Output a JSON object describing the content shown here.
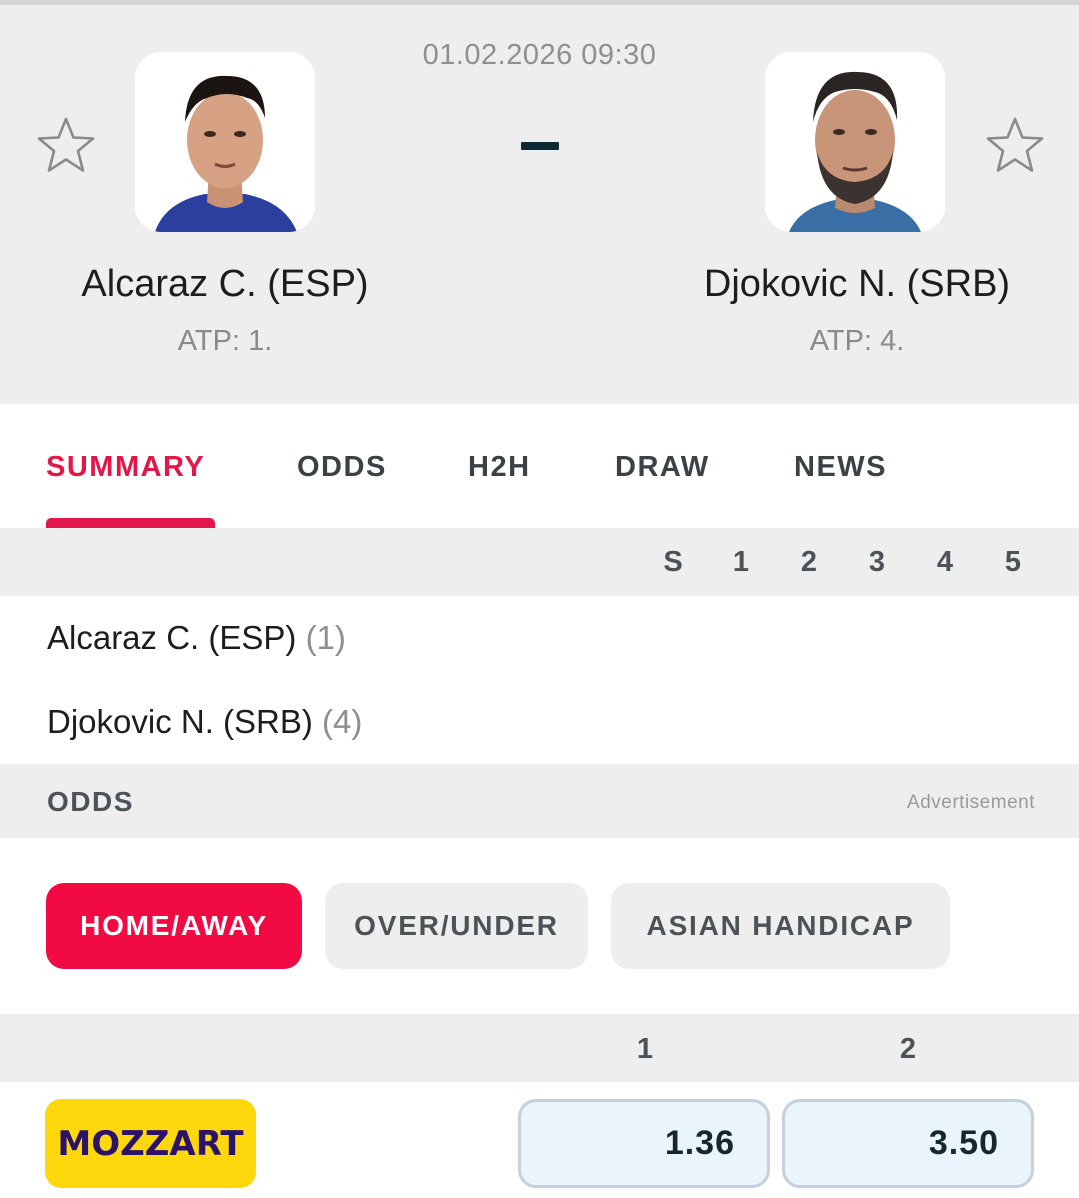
{
  "match": {
    "datetime": "01.02.2026 09:30",
    "score_separator": "-"
  },
  "home": {
    "name": "Alcaraz C. (ESP)",
    "rank_label": "ATP: 1.",
    "seed": "(1)"
  },
  "away": {
    "name": "Djokovic N. (SRB)",
    "rank_label": "ATP: 4.",
    "seed": "(4)"
  },
  "tabs": [
    {
      "label": "SUMMARY",
      "active": true
    },
    {
      "label": "ODDS",
      "active": false
    },
    {
      "label": "H2H",
      "active": false
    },
    {
      "label": "DRAW",
      "active": false
    },
    {
      "label": "NEWS",
      "active": false
    }
  ],
  "scoreboard": {
    "columns": [
      "S",
      "1",
      "2",
      "3",
      "4",
      "5"
    ]
  },
  "odds": {
    "section_title": "ODDS",
    "advert_label": "Advertisement",
    "market_tabs": [
      {
        "label": "HOME/AWAY",
        "active": true
      },
      {
        "label": "OVER/UNDER",
        "active": false
      },
      {
        "label": "ASIAN HANDICAP",
        "active": false
      }
    ],
    "columns": [
      "1",
      "2"
    ],
    "bookmakers": [
      {
        "name": "MOZZART",
        "odds": [
          "1.36",
          "3.50"
        ]
      }
    ]
  },
  "colors": {
    "accent": "#e3164a",
    "pill_active": "#f20a45",
    "bookie_bg": "#fed80c",
    "bookie_text": "#2a1368",
    "odd_bg": "#eaf4fd"
  },
  "icons": {
    "favorite": "star-outline-icon"
  }
}
